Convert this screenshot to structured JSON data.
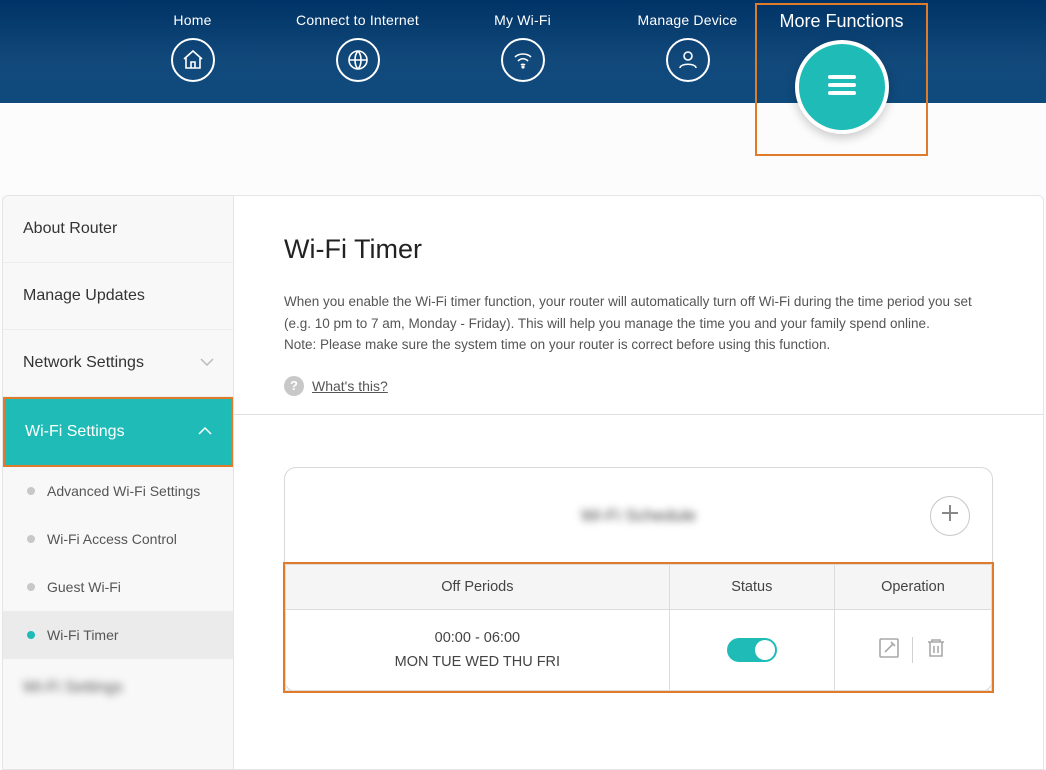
{
  "nav": {
    "items": [
      {
        "label": "Home"
      },
      {
        "label": "Connect to Internet"
      },
      {
        "label": "My Wi-Fi"
      },
      {
        "label": "Manage Device"
      }
    ],
    "more_label": "More Functions"
  },
  "sidebar": {
    "items": [
      {
        "label": "About Router"
      },
      {
        "label": "Manage Updates"
      },
      {
        "label": "Network Settings"
      },
      {
        "label": "Wi-Fi Settings"
      }
    ],
    "subitems": [
      {
        "label": "Advanced Wi-Fi Settings"
      },
      {
        "label": "Wi-Fi Access Control"
      },
      {
        "label": "Guest Wi-Fi"
      },
      {
        "label": "Wi-Fi Timer"
      }
    ],
    "blurred": "Wi-Fi Settings"
  },
  "page": {
    "title": "Wi-Fi Timer",
    "desc_line1": "When you enable the Wi-Fi timer function, your router will automatically turn off Wi-Fi during the time period you set (e.g. 10 pm to 7 am, Monday - Friday). This will help you manage the time you and your family spend online.",
    "desc_line2": "Note: Please make sure the system time on your router is correct before using this function.",
    "whats_this": "What's this?"
  },
  "schedule": {
    "card_title": "Wi-Fi Schedule",
    "columns": [
      "Off Periods",
      "Status",
      "Operation"
    ],
    "rows": [
      {
        "time": "00:00 - 06:00",
        "days": "MON TUE WED THU FRI",
        "status_on": true
      }
    ]
  }
}
